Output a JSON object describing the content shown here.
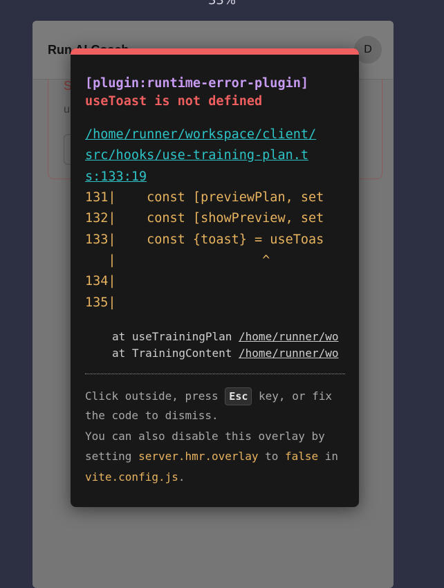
{
  "zoom_label": "33%",
  "app": {
    "title": "Run AI Coach",
    "avatar_initial": "D",
    "error_card": {
      "title": "S",
      "desc": "u"
    }
  },
  "overlay": {
    "plugin": "[plugin:runtime-error-plugin]",
    "message": "useToast is not defined",
    "file_link_lines": [
      "/home/runner/workspace/client/",
      "src/hooks/use-training-plan.t",
      "s:133:19"
    ],
    "frame_lines": [
      "131|    const [previewPlan, set",
      "132|    const [showPreview, set",
      "133|    const {toast} = useToas",
      "   |                   ^",
      "134|",
      "135|"
    ],
    "stack": [
      {
        "prefix": "at useTrainingPlan ",
        "file": "/home/runner/wo"
      },
      {
        "prefix": "at TrainingContent ",
        "file": "/home/runner/wo"
      }
    ],
    "tip": {
      "line1_a": "Click outside, press ",
      "esc_key": "Esc",
      "line1_b": " key, or fix",
      "line2": "the code to dismiss.",
      "line3": "You can also disable this overlay by",
      "line4_a": "setting ",
      "line4_code": "server.hmr.overlay",
      "line4_b": " to ",
      "line4_code2": "false",
      "line4_c": " in",
      "line5_code": "vite.config.js",
      "line5_b": "."
    }
  },
  "colors": {
    "accent_red": "#ef5f5f",
    "plugin_purple": "#c79bf2",
    "link_cyan": "#2ec4c7",
    "code_yellow": "#e8b35e"
  }
}
